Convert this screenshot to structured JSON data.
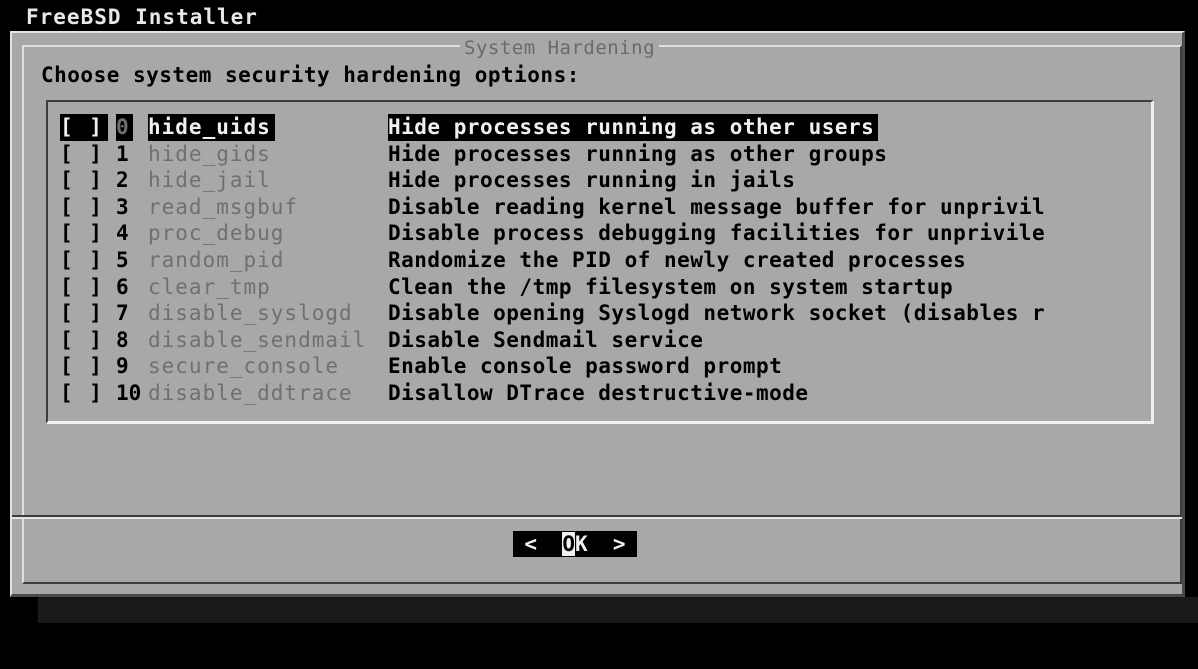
{
  "window": {
    "title": "FreeBSD Installer"
  },
  "dialog": {
    "title": "System Hardening",
    "prompt": "Choose system security hardening options:"
  },
  "options": [
    {
      "checkbox": "[ ]",
      "index": "0",
      "name": "hide_uids",
      "description": "Hide processes running as other users",
      "checked": false,
      "selected": true
    },
    {
      "checkbox": "[ ]",
      "index": "1",
      "name": "hide_gids",
      "description": "Hide processes running as other groups",
      "checked": false,
      "selected": false
    },
    {
      "checkbox": "[ ]",
      "index": "2",
      "name": "hide_jail",
      "description": "Hide processes running in jails",
      "checked": false,
      "selected": false
    },
    {
      "checkbox": "[ ]",
      "index": "3",
      "name": "read_msgbuf",
      "description": "Disable reading kernel message buffer for unprivil",
      "checked": false,
      "selected": false
    },
    {
      "checkbox": "[ ]",
      "index": "4",
      "name": "proc_debug",
      "description": "Disable process debugging facilities for unprivile",
      "checked": false,
      "selected": false
    },
    {
      "checkbox": "[ ]",
      "index": "5",
      "name": "random_pid",
      "description": "Randomize the PID of newly created processes",
      "checked": false,
      "selected": false
    },
    {
      "checkbox": "[ ]",
      "index": "6",
      "name": "clear_tmp",
      "description": "Clean the /tmp filesystem on system startup",
      "checked": false,
      "selected": false
    },
    {
      "checkbox": "[ ]",
      "index": "7",
      "name": "disable_syslogd",
      "description": "Disable opening Syslogd network socket (disables r",
      "checked": false,
      "selected": false
    },
    {
      "checkbox": "[ ]",
      "index": "8",
      "name": "disable_sendmail",
      "description": "Disable Sendmail service",
      "checked": false,
      "selected": false
    },
    {
      "checkbox": "[ ]",
      "index": "9",
      "name": "secure_console",
      "description": "Enable console password prompt",
      "checked": false,
      "selected": false
    },
    {
      "checkbox": "[ ]",
      "index": "10",
      "name": "disable_ddtrace",
      "description": "Disallow DTrace destructive-mode",
      "checked": false,
      "selected": false
    }
  ],
  "buttons": {
    "ok": {
      "left": "<  ",
      "hotkey": "O",
      "rest": "K  >"
    }
  },
  "colors": {
    "background": "#000000",
    "dialog": "#a8a8a8",
    "dim_text": "#707070",
    "highlight_bg": "#000000",
    "highlight_fg": "#f0f0f0"
  }
}
